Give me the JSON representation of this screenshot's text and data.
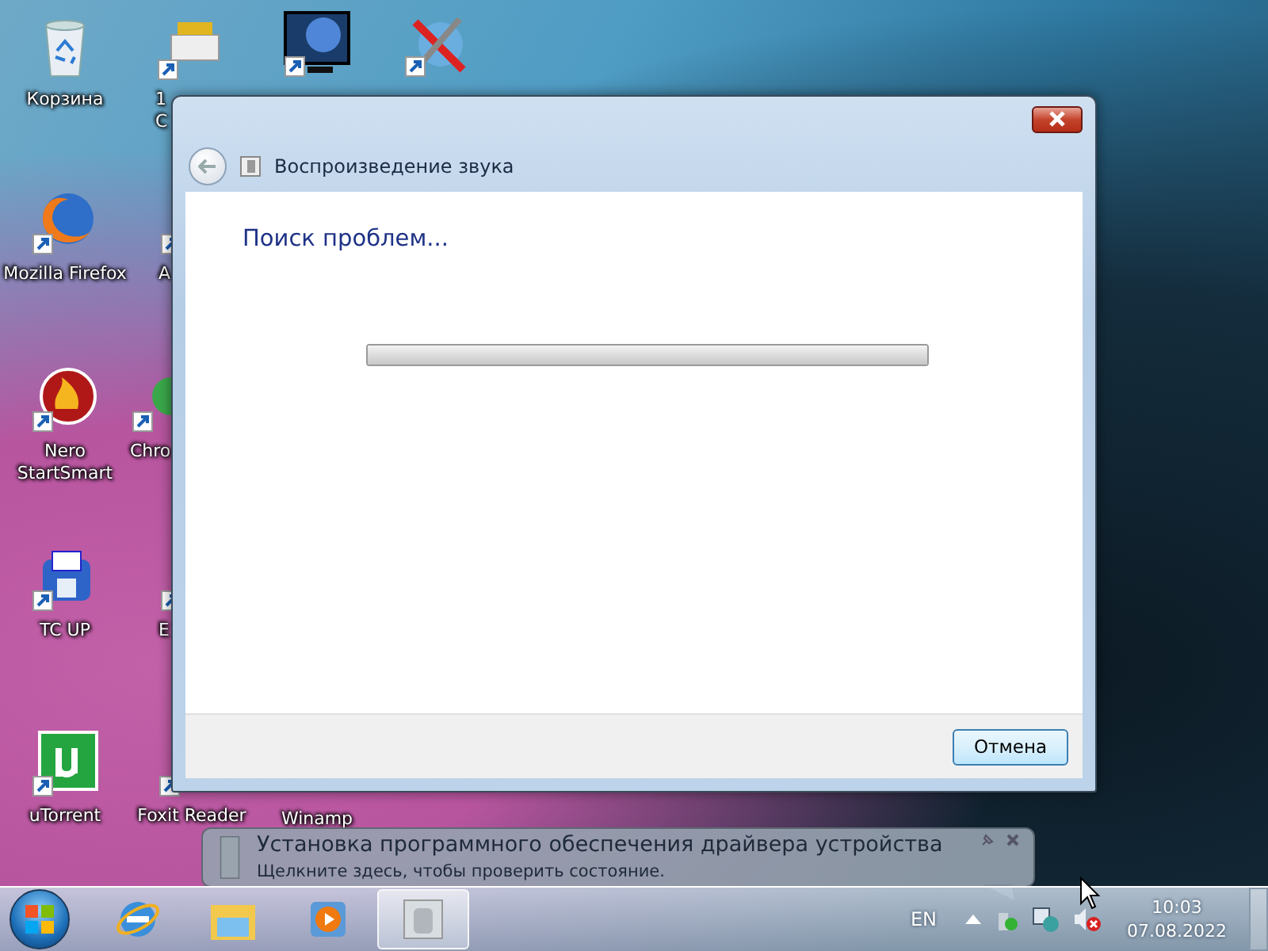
{
  "desktop_icons": [
    {
      "kind": "recycle_bin",
      "label_lines": [
        "Корзина"
      ]
    },
    {
      "kind": "firefox",
      "label_lines": [
        "Mozilla Firefox"
      ]
    },
    {
      "kind": "nero",
      "label_lines": [
        "Nero",
        "StartSmart"
      ]
    },
    {
      "kind": "tcup",
      "label_lines": [
        "TC UP"
      ]
    },
    {
      "kind": "utorrent",
      "label_lines": [
        "uTorrent"
      ]
    },
    {
      "kind": "folder_app",
      "label_lines": [
        "1",
        "С"
      ]
    },
    {
      "kind": "orange_app",
      "label_lines": [
        "A"
      ]
    },
    {
      "kind": "green_app",
      "label_lines": [
        "Chro"
      ]
    },
    {
      "kind": "orange_app",
      "label_lines": [
        "E"
      ]
    },
    {
      "kind": "document",
      "label_lines": [
        "Foxit Reader"
      ]
    },
    {
      "kind": "kmp"
    },
    {
      "kind": "none",
      "label_lines": [
        "Winamp"
      ]
    },
    {
      "kind": "tools"
    }
  ],
  "window": {
    "title": "Воспроизведение звука",
    "heading": "Поиск проблем...",
    "progress": {
      "level": 1
    },
    "buttons": [
      "Отмена"
    ]
  },
  "notification": {
    "title": "Установка программного обеспечения драйвера устройства",
    "text": "Щелкните здесь, чтобы проверить состояние."
  },
  "taskbar": {
    "apps": [
      {
        "kind": "ie",
        "selected": false
      },
      {
        "kind": "explorer",
        "selected": false
      },
      {
        "kind": "media_player",
        "selected": false
      },
      {
        "kind": "troubleshooter",
        "selected": true
      }
    ],
    "language": "EN",
    "time": "10:03",
    "date": "07.08.2022"
  }
}
